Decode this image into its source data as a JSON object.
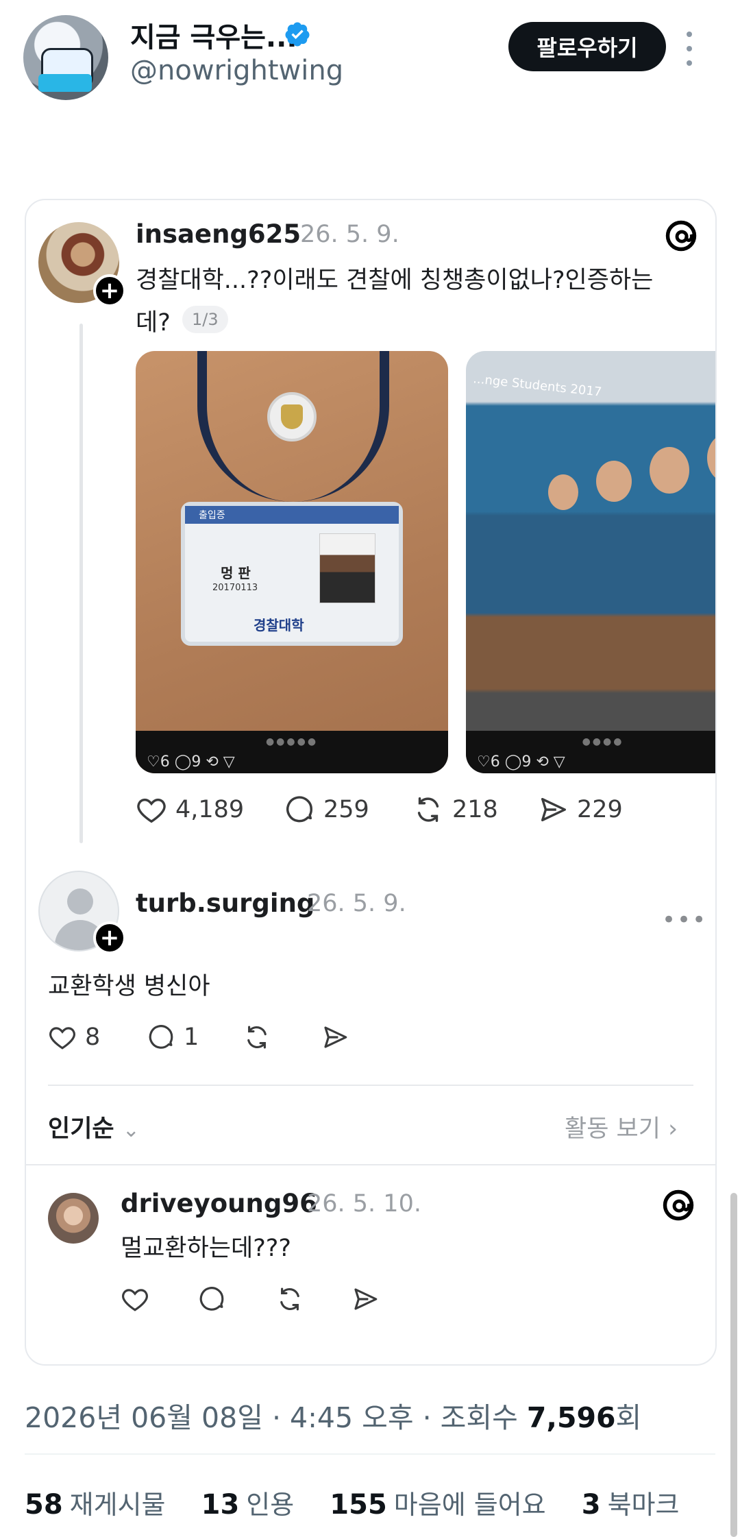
{
  "header": {
    "display_name": "지금 극우는...",
    "handle": "@nowrightwing",
    "follow_label": "팔로우하기"
  },
  "embedded": {
    "post": {
      "username": "insaeng625",
      "date": "26. 5. 9.",
      "text_line1": "경찰대학...??이래도 견찰에 칭챙총이없나?인증하는",
      "text_line2": "데?",
      "pager": "1/3",
      "media1": {
        "band": "출입증",
        "name": "멍 판",
        "number": "20170113",
        "institution": "경찰대학",
        "overlay_icons": "♡6 ◯9 ⟲ ▽"
      },
      "media2": {
        "banner": "...nge Students 2017",
        "overlay_icons": "♡6 ◯9 ⟲ ▽"
      },
      "likes": "4,189",
      "comments": "259",
      "reposts": "218",
      "shares": "229"
    },
    "reply": {
      "username": "turb.surging",
      "date": "26. 5. 9.",
      "text": "교환학생 병신아",
      "likes": "8",
      "comments": "1",
      "more": "•••"
    },
    "sort": {
      "label": "인기순",
      "chevron": "⌄",
      "activity": "활동 보기",
      "activity_chevron": "›"
    },
    "reply2": {
      "username": "driveyoung96",
      "date": "26. 5. 10.",
      "text": "멀교환하는데???"
    }
  },
  "footer": {
    "meta_prefix": "2026년 06월 08일 · 4:45 오후 · 조회수 ",
    "views": "7,596",
    "views_suffix": "회",
    "reposts_count": "58",
    "reposts_label": "재게시물",
    "quotes_count": "13",
    "quotes_label": "인용",
    "likes_count": "155",
    "likes_label": "마음에 들어요",
    "bookmarks_count": "3",
    "bookmarks_label": "북마크"
  },
  "colors": {
    "verified": "#1d9bf0",
    "text_primary": "#0f1419",
    "text_secondary": "#536471",
    "border": "#e7eaee"
  },
  "icons": [
    "verified-badge-icon",
    "more-vertical-icon",
    "threads-logo-icon",
    "heart-icon",
    "comment-icon",
    "repost-icon",
    "share-icon",
    "more-horizontal-icon",
    "chevron-down-icon",
    "chevron-right-icon",
    "plus-icon"
  ]
}
